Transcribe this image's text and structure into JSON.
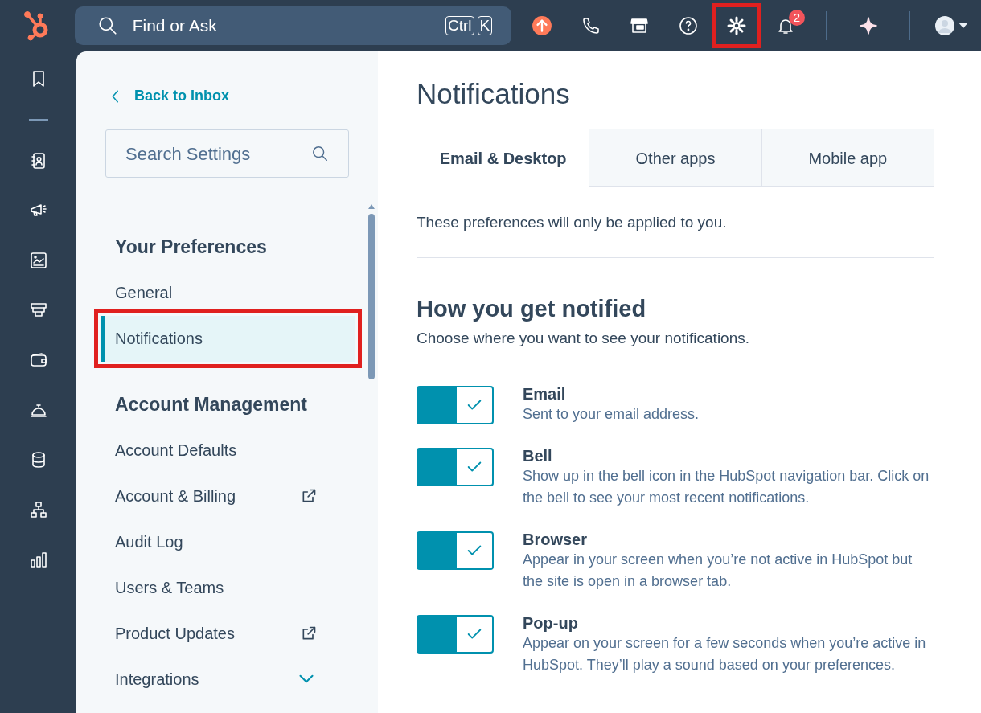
{
  "topbar": {
    "search": {
      "placeholder": "Find or Ask",
      "keys": [
        "Ctrl",
        "K"
      ]
    },
    "icons": [
      {
        "kind": "upgrade",
        "highlighted": false
      },
      {
        "kind": "phone",
        "highlighted": false
      },
      {
        "kind": "marketplace",
        "highlighted": false
      },
      {
        "kind": "help",
        "highlighted": false
      },
      {
        "kind": "settings",
        "highlighted": true
      },
      {
        "kind": "notifications",
        "highlighted": false,
        "badge": "2"
      },
      {
        "kind": "divider"
      },
      {
        "kind": "assistant",
        "highlighted": false
      },
      {
        "kind": "divider"
      },
      {
        "kind": "account",
        "highlighted": false
      }
    ]
  },
  "rail": {
    "items": [
      {
        "kind": "bookmark"
      },
      {
        "kind": "separator"
      },
      {
        "kind": "contacts"
      },
      {
        "kind": "marketing"
      },
      {
        "kind": "content"
      },
      {
        "kind": "sales"
      },
      {
        "kind": "commerce"
      },
      {
        "kind": "service"
      },
      {
        "kind": "data"
      },
      {
        "kind": "automation"
      },
      {
        "kind": "reporting"
      }
    ]
  },
  "sidebar": {
    "back_link": "Back to Inbox",
    "search": {
      "placeholder": "Search Settings"
    },
    "sections": [
      {
        "title": "Your Preferences",
        "items": [
          {
            "label": "General",
            "selected": false,
            "highlighted": false
          },
          {
            "label": "Notifications",
            "selected": true,
            "highlighted": true
          }
        ]
      },
      {
        "title": "Account Management",
        "items": [
          {
            "label": "Account Defaults",
            "selected": false,
            "highlighted": false,
            "kind": "plain"
          },
          {
            "label": "Account & Billing",
            "selected": false,
            "highlighted": false,
            "kind": "external"
          },
          {
            "label": "Audit Log",
            "selected": false,
            "highlighted": false,
            "kind": "plain"
          },
          {
            "label": "Users & Teams",
            "selected": false,
            "highlighted": false,
            "kind": "plain"
          },
          {
            "label": "Product Updates",
            "selected": false,
            "highlighted": false,
            "kind": "external"
          },
          {
            "label": "Integrations",
            "selected": false,
            "highlighted": false,
            "kind": "expandable"
          }
        ]
      }
    ]
  },
  "main": {
    "title": "Notifications",
    "tabs": [
      {
        "label": "Email & Desktop",
        "selected": true
      },
      {
        "label": "Other apps",
        "selected": false
      },
      {
        "label": "Mobile app",
        "selected": false
      }
    ],
    "intro": "These preferences will only be applied to you.",
    "section": {
      "title": "How you get notified",
      "subtitle": "Choose where you want to see your notifications.",
      "channels": [
        {
          "name": "Email",
          "on": true,
          "description": "Sent to your email address."
        },
        {
          "name": "Bell",
          "on": true,
          "description": "Show up in the bell icon in the HubSpot navigation bar. Click on the bell to see your most recent notifications."
        },
        {
          "name": "Browser",
          "on": true,
          "description": "Appear in your screen when you’re not active in HubSpot but the site is open in a browser tab."
        },
        {
          "name": "Pop-up",
          "on": true,
          "description": "Appear on your screen for a few seconds when you’re active in HubSpot. They’ll play a sound based on your preferences."
        }
      ]
    }
  }
}
